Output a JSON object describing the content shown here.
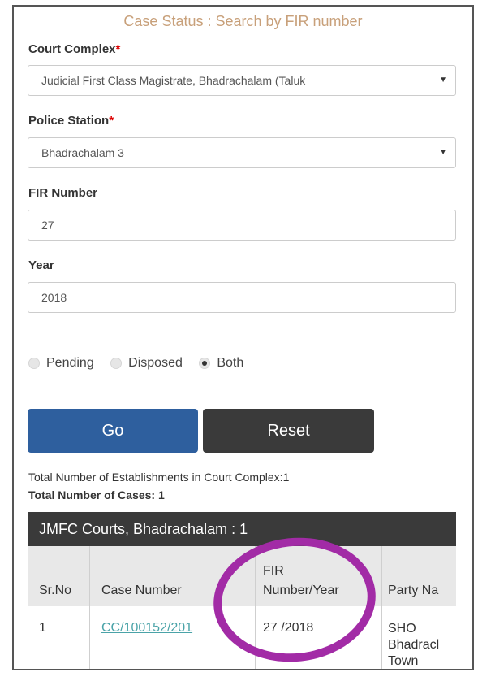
{
  "title": "Case Status : Search by FIR number",
  "court_complex": {
    "label": "Court Complex",
    "required_mark": "*",
    "value": "Judicial First Class Magistrate, Bhadrachalam (Taluk"
  },
  "police_station": {
    "label": "Police Station",
    "required_mark": "*",
    "value": "Bhadrachalam 3"
  },
  "fir_number": {
    "label": "FIR Number",
    "value": "27"
  },
  "year": {
    "label": "Year",
    "value": "2018"
  },
  "status_options": [
    {
      "label": "Pending",
      "selected": false
    },
    {
      "label": "Disposed",
      "selected": false
    },
    {
      "label": "Both",
      "selected": true
    }
  ],
  "buttons": {
    "go": "Go",
    "reset": "Reset"
  },
  "summary": {
    "establishments": "Total Number of Establishments in Court Complex:1",
    "cases": "Total Number of Cases: 1"
  },
  "table": {
    "title": "JMFC Courts, Bhadrachalam : 1",
    "headers": [
      "Sr.No",
      "Case Number",
      "FIR",
      "Number/Year",
      "Party Na"
    ],
    "row": {
      "sr": "1",
      "case_number": "CC/100152/201",
      "fir_year": "27 /2018",
      "party": [
        "SHO",
        "Bhadracl",
        "Town"
      ]
    }
  },
  "colors": {
    "title": "#c8a07a",
    "go_button": "#2e5f9e",
    "reset_button": "#3a3a3a",
    "highlight_circle": "#a22ba6",
    "link": "#4aa3a8"
  },
  "icons": {
    "select_caret": "caret-down-icon"
  }
}
